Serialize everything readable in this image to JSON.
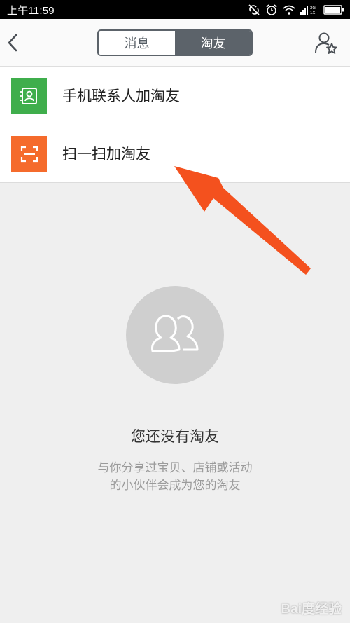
{
  "status_bar": {
    "time": "上午11:59",
    "icons": [
      "sync-disabled-icon",
      "alarm-icon",
      "wifi-icon",
      "signal-icon",
      "battery-icon"
    ]
  },
  "nav": {
    "back_icon": "chevron-left-icon",
    "tabs": [
      {
        "label": "消息",
        "active": false
      },
      {
        "label": "淘友",
        "active": true
      }
    ],
    "right_icon": "add-friend-star-icon"
  },
  "list": {
    "items": [
      {
        "label": "手机联系人加淘友",
        "icon": "contacts-book-icon",
        "icon_color": "#3fae4c"
      },
      {
        "label": "扫一扫加淘友",
        "icon": "scan-icon",
        "icon_color": "#f56b2c"
      }
    ]
  },
  "empty_state": {
    "icon": "friends-icon",
    "title": "您还没有淘友",
    "desc_line1": "与你分享过宝贝、店铺或活动",
    "desc_line2": "的小伙伴会成为您的淘友"
  },
  "annotation": {
    "arrow_color": "#f4511e"
  },
  "watermark": {
    "text": "Bai度经验"
  }
}
